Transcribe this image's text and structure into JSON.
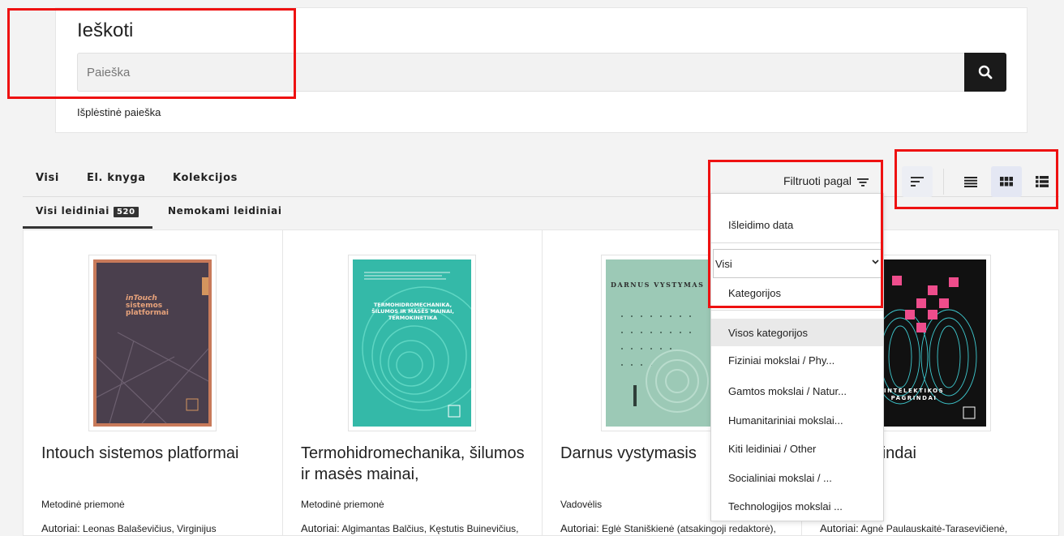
{
  "search": {
    "title": "Ieškoti",
    "placeholder": "Paieška",
    "advanced_link": "Išplėstinė paieška"
  },
  "format_tabs": [
    "Visi",
    "El. knyga",
    "Kolekcijos"
  ],
  "edition_tabs": {
    "all_label": "Visi leidiniai",
    "all_count": "520",
    "free_label": "Nemokami leidiniai"
  },
  "filter": {
    "label": "Filtruoti pagal",
    "sort_option": "Išleidimo data",
    "select_value": "Visi",
    "category_label": "Kategorijos",
    "categories": [
      "Visos kategorijos",
      "Fiziniai mokslai / Phy...",
      "Gamtos mokslai / Natur...",
      "Humanitariniai mokslai...",
      "Kiti leidiniai / Other",
      "Socialiniai mokslai / ...",
      "Technologijos mokslai ..."
    ],
    "active_category": "Visos kategorijos"
  },
  "view_controls": [
    "sort-icon",
    "list-icon",
    "grid-icon",
    "detail-list-icon"
  ],
  "books": [
    {
      "title": "Intouch sistemos platformai",
      "type": "Metodinė priemonė",
      "authors_label": "Autoriai:",
      "authors": "Leonas Balaševičius, Virginijus",
      "cover_text": "inTouch\nsistemos\nplatformai",
      "cover_color": "#4a3f4d",
      "cover_border": "#c87a5a"
    },
    {
      "title": "Termohidromechanika, šilumos ir masės mainai,",
      "type": "Metodinė priemonė",
      "authors_label": "Autoriai:",
      "authors": "Algimantas Balčius, Kęstutis Buinevičius,",
      "cover_text": "TERMOHIDROMECHANIKA,\nŠILUMOS IR MASĖS MAINAI,\nTERMOKINETIKA",
      "cover_color": "#34b9a8"
    },
    {
      "title": "Darnus vystymasis",
      "type": "Vadovėlis",
      "authors_label": "Autoriai:",
      "authors": "Eglė Staniškienė (atsakingoji redaktorė),",
      "cover_text": "DARNUS VYSTYMAS",
      "cover_color": "#9cc9b6"
    },
    {
      "title": "kos pagrindai",
      "type": "",
      "authors_label": "Autoriai:",
      "authors": "Agnė Paulauskaitė-Tarasevičienė,",
      "cover_text": "INTELEKTIKOS\nPAGRINDAI",
      "cover_color": "#111111"
    }
  ],
  "colors": {
    "highlight": "#ee1111",
    "search_button": "#1a1a1a",
    "active_view": "#e4e7f3"
  }
}
